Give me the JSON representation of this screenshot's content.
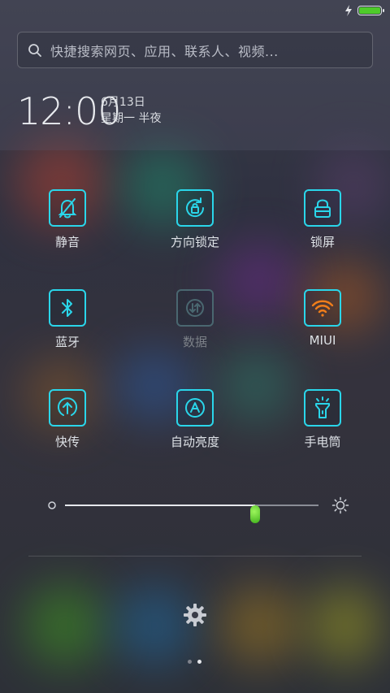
{
  "status_bar": {
    "battery_level": 1.0,
    "charging": true,
    "battery_color": "#4ecb2a"
  },
  "search": {
    "placeholder": "快捷搜索网页、应用、联系人、视频..."
  },
  "clock": {
    "time": "12:00",
    "date": "6月13日",
    "weekday": "星期一 半夜"
  },
  "toggles": [
    {
      "label": "静音",
      "icon": "bell-off-icon",
      "state": "on"
    },
    {
      "label": "方向锁定",
      "icon": "rotation-lock-icon",
      "state": "on"
    },
    {
      "label": "锁屏",
      "icon": "lock-icon",
      "state": "on"
    },
    {
      "label": "蓝牙",
      "icon": "bluetooth-icon",
      "state": "on"
    },
    {
      "label": "数据",
      "icon": "mobile-data-icon",
      "state": "off"
    },
    {
      "label": "MIUI",
      "icon": "wifi-icon",
      "state": "connected"
    },
    {
      "label": "快传",
      "icon": "quick-transfer-icon",
      "state": "on"
    },
    {
      "label": "自动亮度",
      "icon": "auto-brightness-icon",
      "state": "on"
    },
    {
      "label": "手电筒",
      "icon": "flashlight-icon",
      "state": "on"
    }
  ],
  "brightness": {
    "level": 0.75
  },
  "pager": {
    "pages": 2,
    "current": 2
  },
  "colors": {
    "accent": "#2ad6ea",
    "wifi": "#f07d1a",
    "slider_thumb": "#4ecb2a"
  }
}
